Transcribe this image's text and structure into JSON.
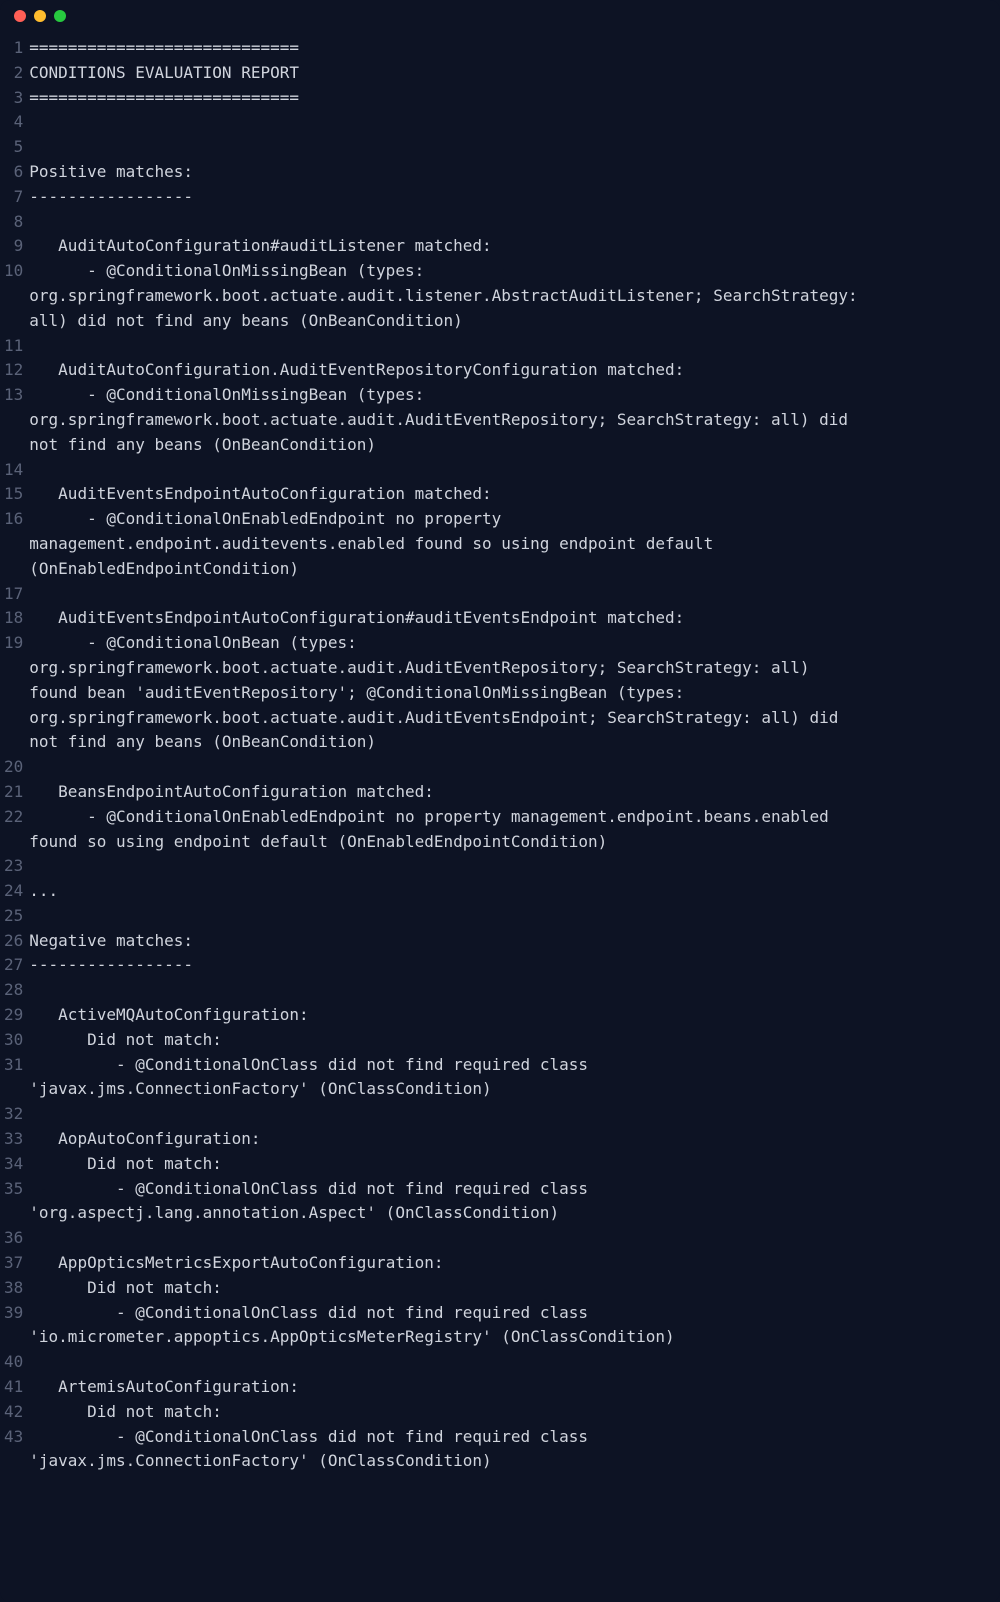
{
  "window": {
    "title": ""
  },
  "editor": {
    "lines": [
      {
        "n": 1,
        "text": "============================",
        "wrap": []
      },
      {
        "n": 2,
        "text": "CONDITIONS EVALUATION REPORT",
        "wrap": []
      },
      {
        "n": 3,
        "text": "============================",
        "wrap": []
      },
      {
        "n": 4,
        "text": "",
        "wrap": []
      },
      {
        "n": 5,
        "text": "",
        "wrap": []
      },
      {
        "n": 6,
        "text": "Positive matches:",
        "wrap": []
      },
      {
        "n": 7,
        "text": "-----------------",
        "wrap": []
      },
      {
        "n": 8,
        "text": "",
        "wrap": []
      },
      {
        "n": 9,
        "text": "   AuditAutoConfiguration#auditListener matched:",
        "wrap": []
      },
      {
        "n": 10,
        "text": "      - @ConditionalOnMissingBean (types: ",
        "wrap": [
          "org.springframework.boot.actuate.audit.listener.AbstractAuditListener; SearchStrategy: ",
          "all) did not find any beans (OnBeanCondition)"
        ]
      },
      {
        "n": 11,
        "text": "",
        "wrap": []
      },
      {
        "n": 12,
        "text": "   AuditAutoConfiguration.AuditEventRepositoryConfiguration matched:",
        "wrap": []
      },
      {
        "n": 13,
        "text": "      - @ConditionalOnMissingBean (types: ",
        "wrap": [
          "org.springframework.boot.actuate.audit.AuditEventRepository; SearchStrategy: all) did ",
          "not find any beans (OnBeanCondition)"
        ]
      },
      {
        "n": 14,
        "text": "",
        "wrap": []
      },
      {
        "n": 15,
        "text": "   AuditEventsEndpointAutoConfiguration matched:",
        "wrap": []
      },
      {
        "n": 16,
        "text": "      - @ConditionalOnEnabledEndpoint no property ",
        "wrap": [
          "management.endpoint.auditevents.enabled found so using endpoint default ",
          "(OnEnabledEndpointCondition)"
        ]
      },
      {
        "n": 17,
        "text": "",
        "wrap": []
      },
      {
        "n": 18,
        "text": "   AuditEventsEndpointAutoConfiguration#auditEventsEndpoint matched:",
        "wrap": []
      },
      {
        "n": 19,
        "text": "      - @ConditionalOnBean (types: ",
        "wrap": [
          "org.springframework.boot.actuate.audit.AuditEventRepository; SearchStrategy: all) ",
          "found bean 'auditEventRepository'; @ConditionalOnMissingBean (types: ",
          "org.springframework.boot.actuate.audit.AuditEventsEndpoint; SearchStrategy: all) did ",
          "not find any beans (OnBeanCondition)"
        ]
      },
      {
        "n": 20,
        "text": "",
        "wrap": []
      },
      {
        "n": 21,
        "text": "   BeansEndpointAutoConfiguration matched:",
        "wrap": []
      },
      {
        "n": 22,
        "text": "      - @ConditionalOnEnabledEndpoint no property management.endpoint.beans.enabled ",
        "wrap": [
          "found so using endpoint default (OnEnabledEndpointCondition)"
        ]
      },
      {
        "n": 23,
        "text": "",
        "wrap": []
      },
      {
        "n": 24,
        "text": "...",
        "wrap": []
      },
      {
        "n": 25,
        "text": "",
        "wrap": []
      },
      {
        "n": 26,
        "text": "Negative matches:",
        "wrap": []
      },
      {
        "n": 27,
        "text": "-----------------",
        "wrap": []
      },
      {
        "n": 28,
        "text": "",
        "wrap": []
      },
      {
        "n": 29,
        "text": "   ActiveMQAutoConfiguration:",
        "wrap": []
      },
      {
        "n": 30,
        "text": "      Did not match:",
        "wrap": []
      },
      {
        "n": 31,
        "text": "         - @ConditionalOnClass did not find required class ",
        "wrap": [
          "'javax.jms.ConnectionFactory' (OnClassCondition)"
        ]
      },
      {
        "n": 32,
        "text": "",
        "wrap": []
      },
      {
        "n": 33,
        "text": "   AopAutoConfiguration:",
        "wrap": []
      },
      {
        "n": 34,
        "text": "      Did not match:",
        "wrap": []
      },
      {
        "n": 35,
        "text": "         - @ConditionalOnClass did not find required class ",
        "wrap": [
          "'org.aspectj.lang.annotation.Aspect' (OnClassCondition)"
        ]
      },
      {
        "n": 36,
        "text": "",
        "wrap": []
      },
      {
        "n": 37,
        "text": "   AppOpticsMetricsExportAutoConfiguration:",
        "wrap": []
      },
      {
        "n": 38,
        "text": "      Did not match:",
        "wrap": []
      },
      {
        "n": 39,
        "text": "         - @ConditionalOnClass did not find required class ",
        "wrap": [
          "'io.micrometer.appoptics.AppOpticsMeterRegistry' (OnClassCondition)"
        ]
      },
      {
        "n": 40,
        "text": "",
        "wrap": []
      },
      {
        "n": 41,
        "text": "   ArtemisAutoConfiguration:",
        "wrap": []
      },
      {
        "n": 42,
        "text": "      Did not match:",
        "wrap": []
      },
      {
        "n": 43,
        "text": "         - @ConditionalOnClass did not find required class ",
        "wrap": [
          "'javax.jms.ConnectionFactory' (OnClassCondition)"
        ]
      }
    ]
  }
}
